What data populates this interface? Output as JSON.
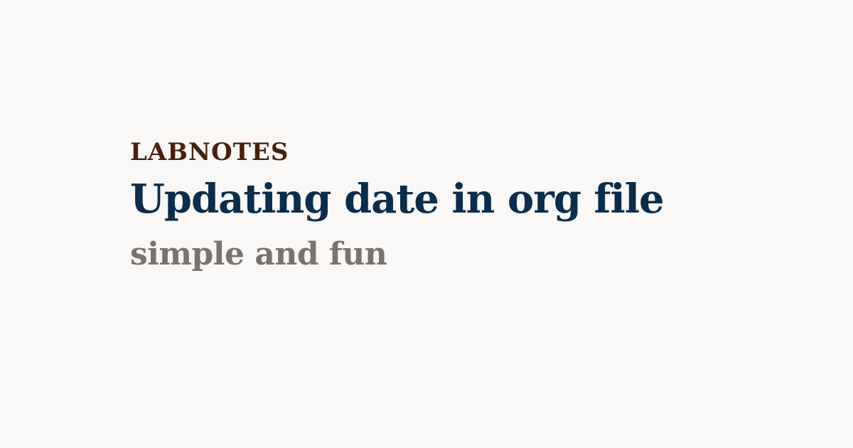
{
  "header": {
    "kicker": "LABNOTES",
    "title": "Updating date in org file",
    "subtitle": "simple and fun"
  },
  "colors": {
    "background": "#f9f8f6",
    "kicker": "#4a1f0c",
    "title": "#0b2d4b",
    "subtitle": "#7a726d"
  }
}
